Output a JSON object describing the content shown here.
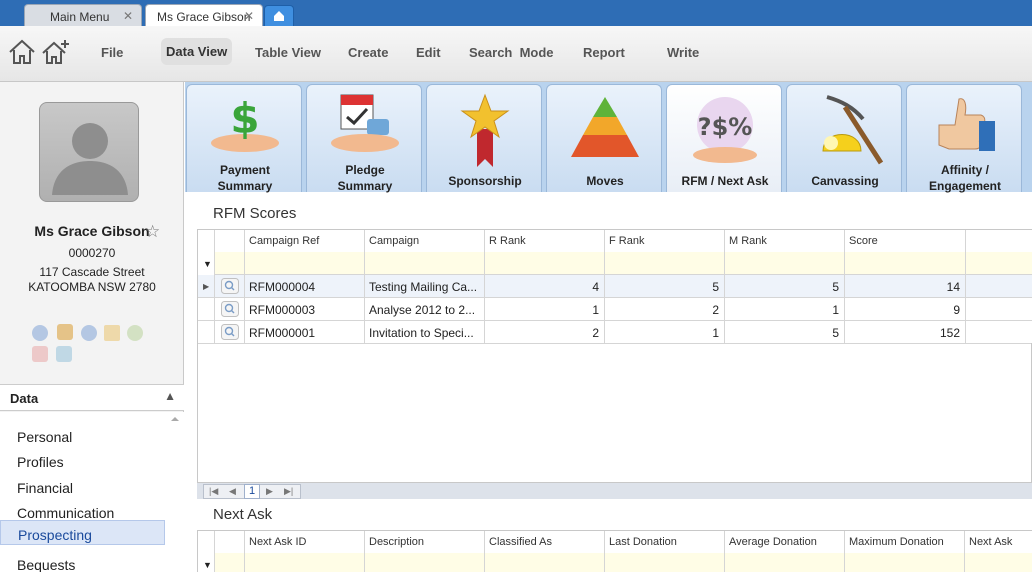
{
  "tabs": [
    {
      "label": "Main Menu"
    },
    {
      "label": "Ms Grace Gibson"
    }
  ],
  "toolbar": {
    "file": "File",
    "data_view": "Data View",
    "table_view": "Table View",
    "create": "Create",
    "edit": "Edit",
    "search_mode": "Search  Mode",
    "report": "Report",
    "write": "Write"
  },
  "contact": {
    "name": "Ms Grace Gibson",
    "id": "0000270",
    "address1": "117 Cascade Street",
    "address2": "KATOOMBA NSW 2780"
  },
  "data_panel": {
    "title": "Data",
    "items": [
      "Personal",
      "Profiles",
      "Financial",
      "Communication",
      "Prospecting",
      "Bequests"
    ],
    "selected": "Prospecting"
  },
  "module_tabs": [
    {
      "line1": "Payment",
      "line2": "Summary",
      "icon": "money-hand-icon"
    },
    {
      "line1": "Pledge",
      "line2": "Summary",
      "icon": "calendar-hand-icon"
    },
    {
      "line1": "Sponsorship",
      "line2": "",
      "icon": "star-ribbon-icon"
    },
    {
      "line1": "Moves",
      "line2": "",
      "icon": "pyramid-icon"
    },
    {
      "line1": "RFM / Next Ask",
      "line2": "",
      "icon": "rfm-icon"
    },
    {
      "line1": "Canvassing",
      "line2": "",
      "icon": "pickaxe-helmet-icon"
    },
    {
      "line1": "Affinity /",
      "line2": "Engagement",
      "icon": "thumbs-up-icon"
    }
  ],
  "rfm": {
    "title": "RFM Scores",
    "columns": [
      "Campaign Ref",
      "Campaign",
      "R Rank",
      "F Rank",
      "M Rank",
      "Score"
    ],
    "rows": [
      {
        "ref": "RFM000004",
        "campaign": "Testing Mailing Ca...",
        "r": "4",
        "f": "5",
        "m": "5",
        "score": "14"
      },
      {
        "ref": "RFM000003",
        "campaign": "Analyse 2012 to 2...",
        "r": "1",
        "f": "2",
        "m": "1",
        "score": "9"
      },
      {
        "ref": "RFM000001",
        "campaign": "Invitation to Speci...",
        "r": "2",
        "f": "1",
        "m": "5",
        "score": "152"
      }
    ],
    "page": "1"
  },
  "next_ask": {
    "title": "Next Ask",
    "columns": [
      "Next Ask ID",
      "Description",
      "Classified As",
      "Last Donation",
      "Average Donation",
      "Maximum Donation",
      "Next Ask"
    ]
  }
}
